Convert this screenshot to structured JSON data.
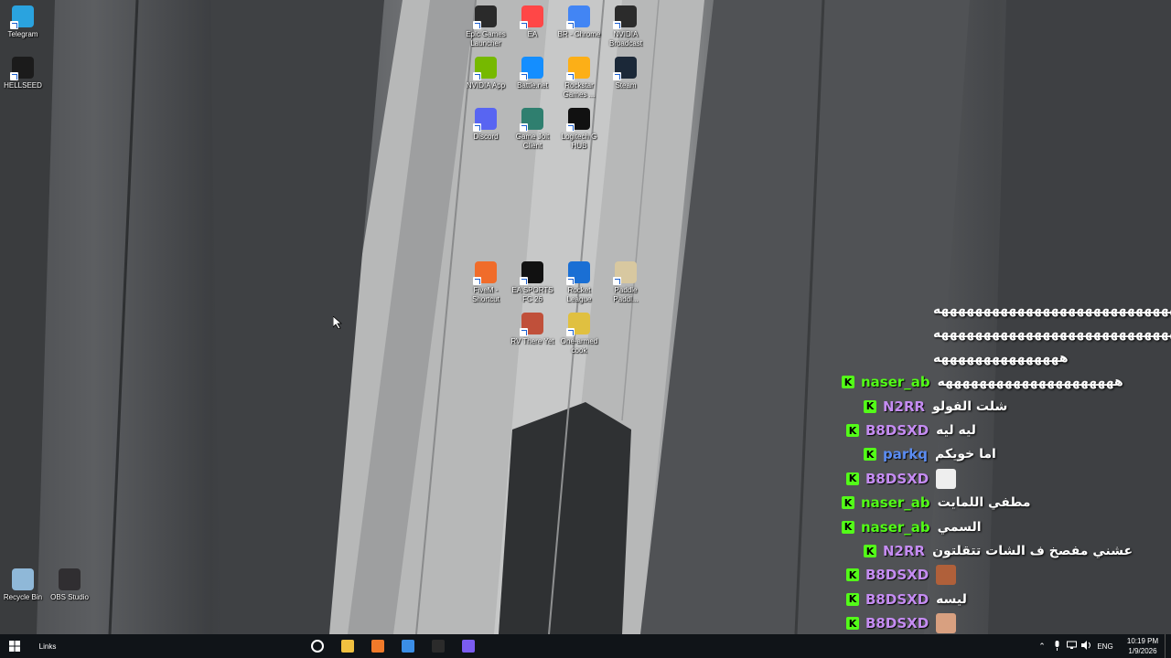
{
  "desktop_icons": [
    {
      "label": "Telegram",
      "icon": "telegram-icon",
      "color": "#2aa3df"
    },
    {
      "label": "HELLSEED",
      "icon": "hellseed-icon",
      "color": "#1b1b1b"
    },
    {
      "label": "Epic Games\nLauncher",
      "icon": "epic-games-icon",
      "color": "#2a2a2a"
    },
    {
      "label": "EA",
      "icon": "ea-icon",
      "color": "#ff4747"
    },
    {
      "label": "BR - Chrome",
      "icon": "chrome-icon",
      "color": "#4285f4"
    },
    {
      "label": "NVIDIA\nBroadcast",
      "icon": "nvidia-broadcast-icon",
      "color": "#2b2b2b"
    },
    {
      "label": "NVIDIA App",
      "icon": "nvidia-app-icon",
      "color": "#76b900"
    },
    {
      "label": "Battle.net",
      "icon": "battlenet-icon",
      "color": "#148eff"
    },
    {
      "label": "Rockstar\nGames ...",
      "icon": "rockstar-icon",
      "color": "#fcaf17"
    },
    {
      "label": "Steam",
      "icon": "steam-icon",
      "color": "#1b2838"
    },
    {
      "label": "Discord",
      "icon": "discord-icon",
      "color": "#5865f2"
    },
    {
      "label": "Game Jolt\nClient",
      "icon": "gamejolt-icon",
      "color": "#2f7f6f"
    },
    {
      "label": "Logitech G\nHUB",
      "icon": "logitech-icon",
      "color": "#111111"
    },
    {
      "label": "FiveM -\nShortcut",
      "icon": "fivem-icon",
      "color": "#f06c2a"
    },
    {
      "label": "EA SPORTS\nFC 26",
      "icon": "fc26-icon",
      "color": "#111111"
    },
    {
      "label": "Rocket\nLeague",
      "icon": "rocket-league-icon",
      "color": "#1a6fd4"
    },
    {
      "label": "Paddle\nPaddl...",
      "icon": "paddle-icon",
      "color": "#d8c8a0"
    },
    {
      "label": "RV There Yet",
      "icon": "rv-icon",
      "color": "#c0503a"
    },
    {
      "label": "One-armed\ncook",
      "icon": "cook-icon",
      "color": "#e0c040"
    },
    {
      "label": "Recycle Bin",
      "icon": "recycle-bin-icon",
      "color": "#8fb8d8"
    },
    {
      "label": "OBS Studio",
      "icon": "obs-icon",
      "color": "#302e31"
    }
  ],
  "chat": {
    "badge_letter": "K",
    "badge_color": "#53fc18",
    "messages": [
      {
        "user": "",
        "user_color": "",
        "text": "ههههههههههههههههههههههههههههههه"
      },
      {
        "user": "",
        "user_color": "",
        "text": "ههههههههههههههههههههههههههههههه"
      },
      {
        "user": "",
        "user_color": "",
        "text": "هههههههههههههههه"
      },
      {
        "user": "naser_ab",
        "user_color": "#53fc18",
        "text": "هههههههههههههههههههههه"
      },
      {
        "user": "N2RR",
        "user_color": "#c58cf2",
        "text": "شلت الفولو"
      },
      {
        "user": "B8DSXD",
        "user_color": "#c58cf2",
        "text": "ليه ليه"
      },
      {
        "user": "parkq",
        "user_color": "#5b8cf2",
        "text": "اما خويكم"
      },
      {
        "user": "B8DSXD",
        "user_color": "#c58cf2",
        "text": "",
        "emote": "emote-face-1"
      },
      {
        "user": "naser_ab",
        "user_color": "#53fc18",
        "text": "مطفي اللمايت"
      },
      {
        "user": "naser_ab",
        "user_color": "#53fc18",
        "text": "السمي"
      },
      {
        "user": "N2RR",
        "user_color": "#c58cf2",
        "text": "عشني مفصخ ف الشات تتقلتون"
      },
      {
        "user": "B8DSXD",
        "user_color": "#c58cf2",
        "text": "",
        "emote": "emote-face-2"
      },
      {
        "user": "B8DSXD",
        "user_color": "#c58cf2",
        "text": "ليسه"
      },
      {
        "user": "B8DSXD",
        "user_color": "#c58cf2",
        "text": "",
        "emote": "emote-face-3"
      }
    ]
  },
  "taskbar": {
    "links_label": "Links",
    "apps": [
      "settings-icon",
      "file-explorer-icon",
      "fivem-taskbar-icon",
      "microsoft-store-icon",
      "bm-app-icon",
      "video-app-icon"
    ],
    "tray": {
      "language": "ENG",
      "time": "10:19 PM",
      "date": "1/9/2026"
    }
  }
}
